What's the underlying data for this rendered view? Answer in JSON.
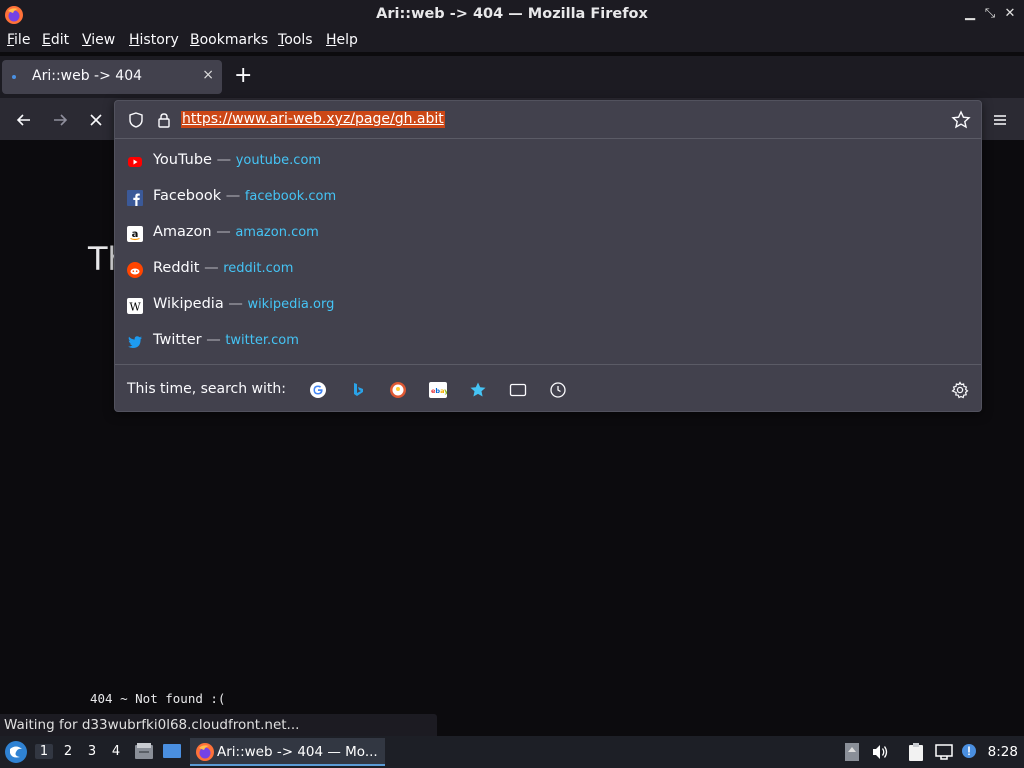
{
  "window": {
    "title": "Ari::web -> 404 — Mozilla Firefox"
  },
  "menubar": {
    "items": [
      {
        "label": "File",
        "underline": "F",
        "rest": "ile"
      },
      {
        "label": "Edit",
        "underline": "E",
        "rest": "dit"
      },
      {
        "label": "View",
        "underline": "V",
        "rest": "iew"
      },
      {
        "label": "History",
        "underline": "H",
        "rest": "istory"
      },
      {
        "label": "Bookmarks",
        "underline": "B",
        "rest": "ookmarks"
      },
      {
        "label": "Tools",
        "underline": "T",
        "rest": "ools"
      },
      {
        "label": "Help",
        "underline": "H",
        "rest": "elp"
      }
    ]
  },
  "tab": {
    "label": "Ari::web -> 404",
    "close": "×"
  },
  "newtab": {
    "label": "+"
  },
  "urlbar": {
    "value": "https://www.ari-web.xyz/page/gh.abit"
  },
  "suggestions": [
    {
      "title": "YouTube",
      "sep": "—",
      "url": "youtube.com",
      "icon": "youtube-icon"
    },
    {
      "title": "Facebook",
      "sep": "—",
      "url": "facebook.com",
      "icon": "facebook-icon"
    },
    {
      "title": "Amazon",
      "sep": "—",
      "url": "amazon.com",
      "icon": "amazon-icon"
    },
    {
      "title": "Reddit",
      "sep": "—",
      "url": "reddit.com",
      "icon": "reddit-icon"
    },
    {
      "title": "Wikipedia",
      "sep": "—",
      "url": "wikipedia.org",
      "icon": "wikipedia-icon"
    },
    {
      "title": "Twitter",
      "sep": "—",
      "url": "twitter.com",
      "icon": "twitter-icon"
    }
  ],
  "oneoff": {
    "label": "This time, search with:",
    "engines": [
      "google-icon",
      "bing-icon",
      "duckduckgo-icon",
      "ebay-icon",
      "bookmarks-star-icon",
      "tabs-icon",
      "history-clock-icon"
    ]
  },
  "page": {
    "heading": "Th",
    "not_found": "404 ~ Not found :("
  },
  "status": {
    "text": "Waiting for d33wubrfki0l68.cloudfront.net..."
  },
  "taskbar": {
    "workspaces": [
      "1",
      "2",
      "3",
      "4"
    ],
    "app_label": "Ari::web -> 404 — Mo...",
    "clock": "8:28"
  },
  "colors": {
    "accent": "#cc4716",
    "link": "#45c4f5",
    "panel": "#42414d",
    "toolbar": "#2b2a33",
    "chrome": "#1c1b22"
  }
}
